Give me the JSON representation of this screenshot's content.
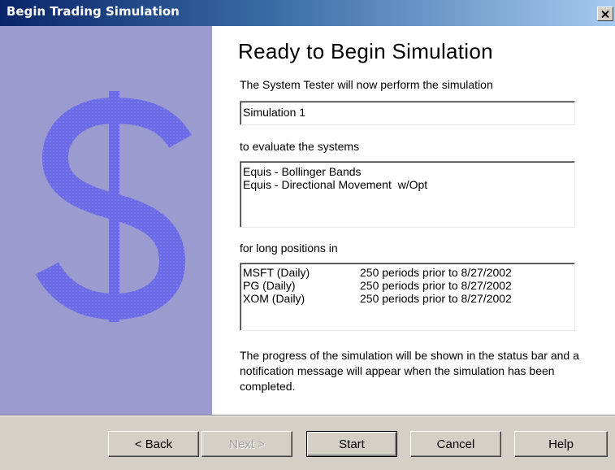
{
  "window": {
    "title": "Begin Trading Simulation",
    "close_icon": "close-icon"
  },
  "sidebar": {
    "icon": "dollar-sign-icon",
    "color": "#9b9bd0",
    "glyph_color": "#6a6ae6"
  },
  "main": {
    "heading": "Ready to Begin Simulation",
    "intro": "The System Tester will now perform the simulation",
    "simulation_name": "Simulation 1",
    "systems_label": "to evaluate the systems",
    "systems": [
      "Equis - Bollinger Bands",
      "Equis - Directional Movement  w/Opt"
    ],
    "positions_label": "for long positions in",
    "positions": [
      {
        "symbol": "MSFT (Daily)",
        "range": "250 periods prior to 8/27/2002"
      },
      {
        "symbol": "PG (Daily)",
        "range": "250 periods prior to 8/27/2002"
      },
      {
        "symbol": "XOM (Daily)",
        "range": "250 periods prior to 8/27/2002"
      }
    ],
    "progress_note": "The progress of the simulation will be shown in the status bar and a notification message will appear when the simulation has been completed."
  },
  "buttons": {
    "back": "< Back",
    "next": "Next >",
    "start": "Start",
    "cancel": "Cancel",
    "help": "Help"
  }
}
